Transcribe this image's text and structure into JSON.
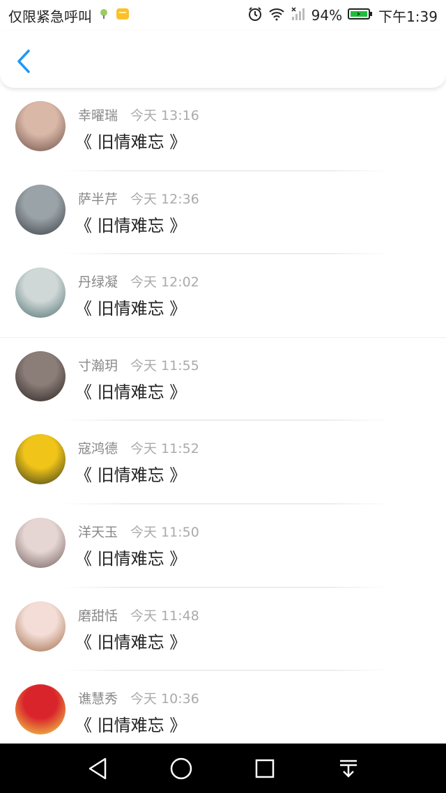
{
  "status_bar": {
    "carrier_text": "仅限紧急呼叫",
    "battery_percent": "94%",
    "time": "下午1:39",
    "icons": [
      "weather-icon",
      "notification-icon",
      "alarm-icon",
      "wifi-icon",
      "signal-icon",
      "battery-charging-icon"
    ]
  },
  "header": {
    "back_icon": "chevron-left-icon",
    "accent_color": "#2196F3"
  },
  "list": {
    "items": [
      {
        "name": "幸曜瑞",
        "time": "今天 13:16",
        "title": "《 旧情难忘 》",
        "avatar_colors": [
          "#d9b8a8",
          "#6d4f45"
        ]
      },
      {
        "name": "萨半芹",
        "time": "今天 12:36",
        "title": "《 旧情难忘 》",
        "avatar_colors": [
          "#9aa3a8",
          "#3a3f44"
        ]
      },
      {
        "name": "丹绿凝",
        "time": "今天 12:02",
        "title": "《 旧情难忘 》",
        "avatar_colors": [
          "#cfd8d6",
          "#4f6f73"
        ]
      },
      {
        "name": "寸瀚玥",
        "time": "今天 11:55",
        "title": "《 旧情难忘 》",
        "avatar_colors": [
          "#8b7d78",
          "#2a2220"
        ]
      },
      {
        "name": "寇鸿德",
        "time": "今天 11:52",
        "title": "《 旧情难忘 》",
        "avatar_colors": [
          "#f0c419",
          "#3b3a1a"
        ]
      },
      {
        "name": "洋天玉",
        "time": "今天 11:50",
        "title": "《 旧情难忘 》",
        "avatar_colors": [
          "#e6d6d3",
          "#6e5c5a"
        ]
      },
      {
        "name": "磨甜恬",
        "time": "今天 11:48",
        "title": "《 旧情难忘 》",
        "avatar_colors": [
          "#f3ddd6",
          "#a06a46"
        ]
      },
      {
        "name": "谯慧秀",
        "time": "今天 10:36",
        "title": "《 旧情难忘 》",
        "avatar_colors": [
          "#d9242b",
          "#f4e04d"
        ]
      }
    ]
  },
  "nav_bar": {
    "icons": [
      "back-triangle-icon",
      "home-circle-icon",
      "recents-square-icon",
      "notification-pull-icon"
    ]
  }
}
